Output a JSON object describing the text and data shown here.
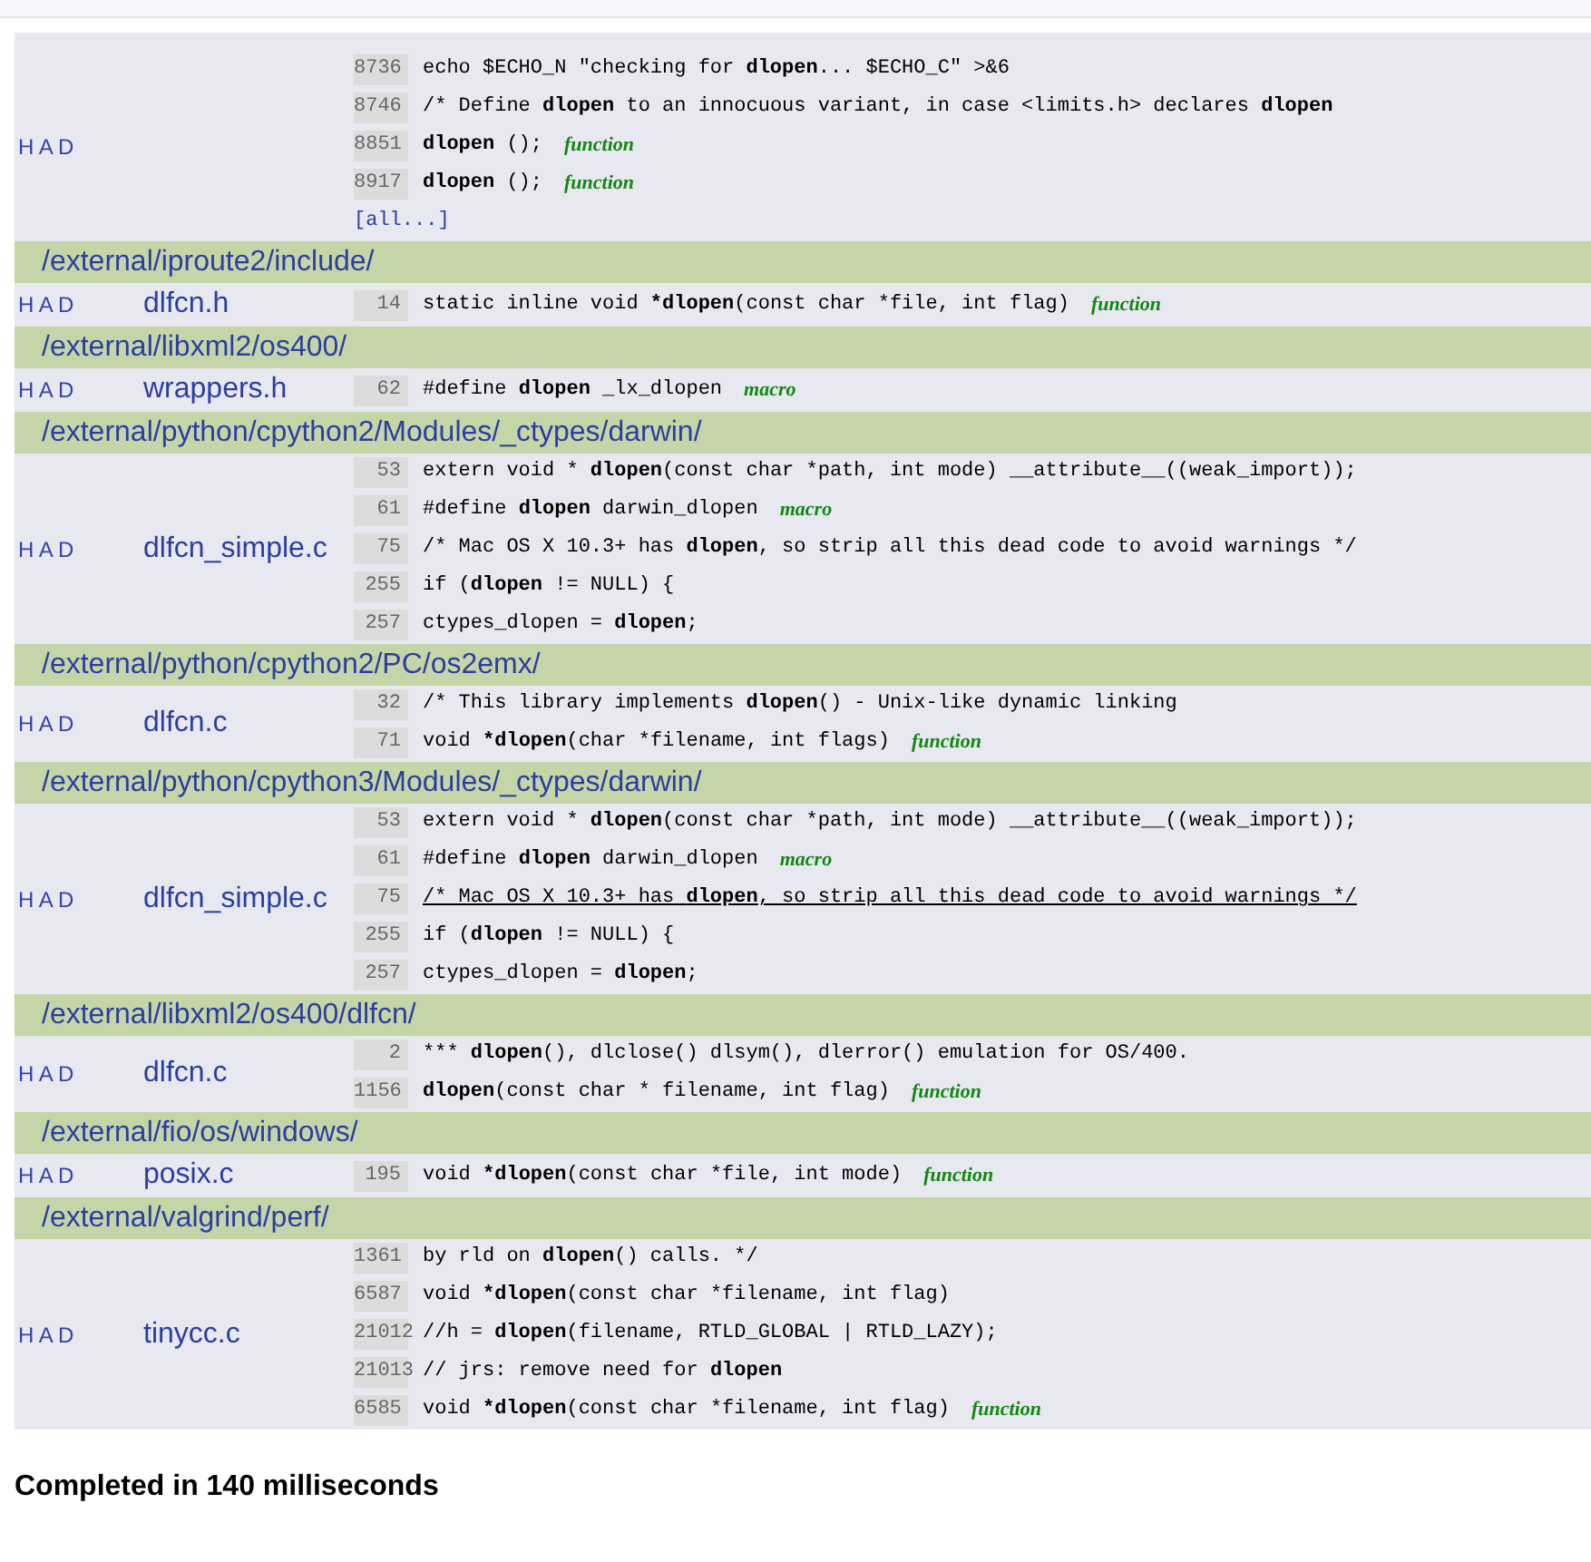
{
  "groups": [
    {
      "files": [
        {
          "had": "H A D",
          "more": "[all...]",
          "lines": [
            {
              "num": "8736",
              "code": "echo $ECHO_N \"checking for **dlopen**... $ECHO_C\" >&6",
              "hovered": false
            },
            {
              "num": "8746",
              "code": "/* Define **dlopen** to an innocuous variant, in case <limits.h> declares **dlopen**",
              "hovered": false
            },
            {
              "num": "8851",
              "code": "**dlopen** ();",
              "tag": "function",
              "hovered": false
            },
            {
              "num": "8917",
              "code": "**dlopen** ();",
              "tag": "function",
              "hovered": false
            }
          ]
        }
      ]
    },
    {
      "path": "/external/iproute2/include/",
      "files": [
        {
          "had": "H A D",
          "name": "dlfcn.h",
          "lines": [
            {
              "num": "14",
              "code": "static inline void ***dlopen**(const char *file, int flag)",
              "tag": "function",
              "hovered": false
            }
          ]
        }
      ]
    },
    {
      "path": "/external/libxml2/os400/",
      "files": [
        {
          "had": "H A D",
          "name": "wrappers.h",
          "lines": [
            {
              "num": "62",
              "code": "#define **dlopen** _lx_dlopen",
              "tag": "macro",
              "hovered": false
            }
          ]
        }
      ]
    },
    {
      "path": "/external/python/cpython2/Modules/_ctypes/darwin/",
      "files": [
        {
          "had": "H A D",
          "name": "dlfcn_simple.c",
          "lines": [
            {
              "num": "53",
              "code": "extern void * **dlopen**(const char *path, int mode) __attribute__((weak_import));",
              "hovered": false
            },
            {
              "num": "61",
              "code": "#define **dlopen** darwin_dlopen",
              "tag": "macro",
              "hovered": false
            },
            {
              "num": "75",
              "code": "/* Mac OS X 10.3+ has **dlopen**, so strip all this dead code to avoid warnings */",
              "hovered": false
            },
            {
              "num": "255",
              "code": "if (**dlopen** != NULL) {",
              "hovered": false
            },
            {
              "num": "257",
              "code": "ctypes_dlopen = **dlopen**;",
              "hovered": false
            }
          ]
        }
      ]
    },
    {
      "path": "/external/python/cpython2/PC/os2emx/",
      "files": [
        {
          "had": "H A D",
          "name": "dlfcn.c",
          "lines": [
            {
              "num": "32",
              "code": "/* This library implements **dlopen**() - Unix-like dynamic linking",
              "hovered": false
            },
            {
              "num": "71",
              "code": "void ***dlopen**(char *filename, int flags)",
              "tag": "function",
              "hovered": false
            }
          ]
        }
      ]
    },
    {
      "path": "/external/python/cpython3/Modules/_ctypes/darwin/",
      "files": [
        {
          "had": "H A D",
          "name": "dlfcn_simple.c",
          "lines": [
            {
              "num": "53",
              "code": "extern void * **dlopen**(const char *path, int mode) __attribute__((weak_import));",
              "hovered": false
            },
            {
              "num": "61",
              "code": "#define **dlopen** darwin_dlopen",
              "tag": "macro",
              "hovered": false
            },
            {
              "num": "75",
              "code": "/* Mac OS X 10.3+ has **dlopen**, so strip all this dead code to avoid warnings */",
              "hovered": true
            },
            {
              "num": "255",
              "code": "if (**dlopen** != NULL) {",
              "hovered": false
            },
            {
              "num": "257",
              "code": "ctypes_dlopen = **dlopen**;",
              "hovered": false
            }
          ]
        }
      ]
    },
    {
      "path": "/external/libxml2/os400/dlfcn/",
      "files": [
        {
          "had": "H A D",
          "name": "dlfcn.c",
          "lines": [
            {
              "num": "2",
              "prefix": "*** ",
              "code": "**dlopen**(), dlclose() dlsym(), dlerror() emulation for OS/400.",
              "hovered": false
            },
            {
              "num": "1156",
              "code": "**dlopen**(const char * filename, int flag)",
              "tag": "function",
              "hovered": false
            }
          ]
        }
      ]
    },
    {
      "path": "/external/fio/os/windows/",
      "files": [
        {
          "had": "H A D",
          "name": "posix.c",
          "lines": [
            {
              "num": "195",
              "code": "void ***dlopen**(const char *file, int mode)",
              "tag": "function",
              "hovered": false
            }
          ]
        }
      ]
    },
    {
      "path": "/external/valgrind/perf/",
      "files": [
        {
          "had": "H A D",
          "name": "tinycc.c",
          "lines": [
            {
              "num": "1361",
              "code": "by rld on **dlopen**() calls. */",
              "hovered": false
            },
            {
              "num": "6587",
              "code": "void ***dlopen**(const char *filename, int flag)",
              "hovered": false
            },
            {
              "num": "21012",
              "code": "//h = **dlopen**(filename, RTLD_GLOBAL | RTLD_LAZY);",
              "hovered": false
            },
            {
              "num": "21013",
              "code": "// jrs: remove need for **dlopen**",
              "hovered": false
            },
            {
              "num": "6585",
              "code": "void ***dlopen**(const char *filename, int flag)",
              "tag": "function",
              "hovered": false
            }
          ]
        }
      ]
    }
  ],
  "status": "Completed in 140 milliseconds"
}
